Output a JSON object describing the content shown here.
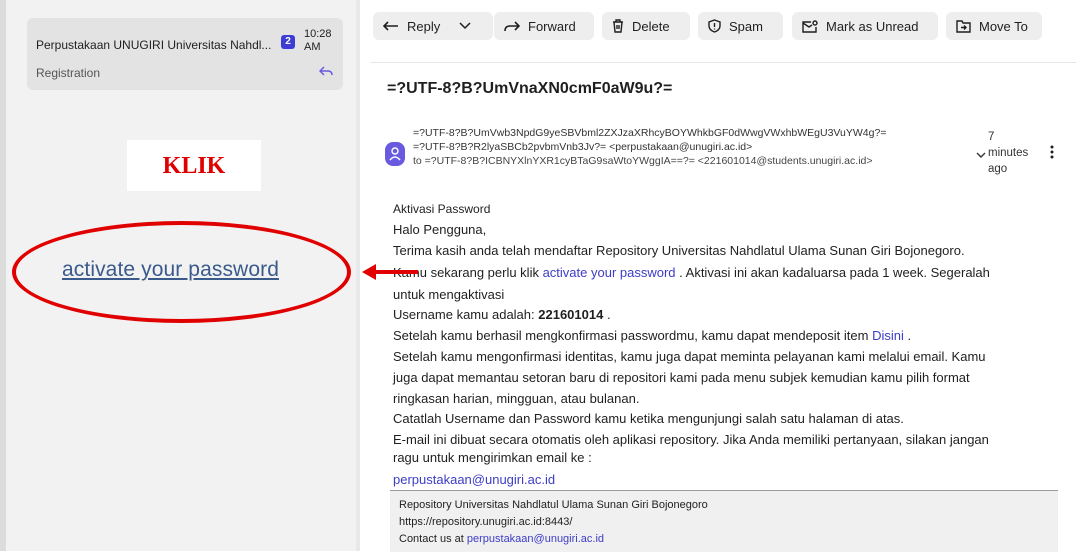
{
  "colors": {
    "accent": "#3c3cc8",
    "annotation_red": "#e00000",
    "badge": "#3d3dd6",
    "avatar": "#6a5ae0"
  },
  "inbox": {
    "item": {
      "sender": "Perpustakaan UNUGIRI Universitas Nahdl...",
      "badge_count": "2",
      "time_line1": "10:28",
      "time_line2": "AM",
      "subject": "Registration",
      "reply_icon": "reply-icon"
    }
  },
  "annotation": {
    "klik": "KLIK",
    "zoomed_link": "activate your password"
  },
  "toolbar": {
    "reply": "Reply",
    "forward": "Forward",
    "delete": "Delete",
    "spam": "Spam",
    "mark_unread": "Mark as Unread",
    "move_to": "Move To"
  },
  "email": {
    "subject": "=?UTF-8?B?UmVnaXN0cmF0aW9u?=",
    "from_line1": "=?UTF-8?B?UmVwb3NpdG9yeSBVbml2ZXJzaXRhcyBOYWhkbGF0dWwgVWxhbWEgU3VuYW4g?=",
    "from_line2": "=?UTF-8?B?R2lyaSBCb2pvbmVnb3Jv?= <perpustakaan@unugiri.ac.id>",
    "to_line": "to =?UTF-8?B?ICBNYXlnYXR1cyBTaG9saWtoYWggIA==?= <221601014@students.unugiri.ac.id>",
    "when_line1": "7",
    "when_line2": "minutes",
    "when_line3": "ago",
    "body": {
      "aktivasi": "Aktivasi Password",
      "halo": "Halo Pengguna,",
      "terima": "Terima kasih anda telah mendaftar Repository Universitas Nahdlatul Ulama Sunan Giri Bojonegoro.",
      "kamu_prefix": "Kamu sekarang perlu klik ",
      "kamu_link": "activate your password",
      "kamu_suffix": " . Aktivasi ini akan kadaluarsa pada 1 week. Segeralah",
      "kamu_line2": "untuk mengaktivasi",
      "user_prefix": "Username kamu adalah: ",
      "user_value": "221601014",
      "user_suffix": " .",
      "setelah1_prefix": "Setelah kamu berhasil mengkonfirmasi passwordmu, kamu dapat mendeposit item ",
      "setelah1_link": "Disini",
      "setelah1_suffix": " .",
      "setelah2_line1": "Setelah kamu mengonfirmasi identitas, kamu juga dapat meminta pelayanan kami melalui email. Kamu",
      "setelah2_line2": "juga dapat memantau setoran baru di repositori kami pada menu subjek kemudian kamu pilih format",
      "setelah2_line3": "ringkasan harian, mingguan, atau bulanan.",
      "catat": "Catatlah Username dan Password kamu ketika mengunjungi salah satu halaman di atas.",
      "email_line1": "E-mail ini dibuat secara otomatis oleh aplikasi repository. Jika Anda memiliki pertanyaan, silakan jangan",
      "email_line2": "ragu untuk mengirimkan email ke :",
      "contact_email": "perpustakaan@unugiri.ac.id"
    },
    "footer": {
      "line1": "Repository Universitas Nahdlatul Ulama Sunan Giri Bojonegoro",
      "url": "https://repository.unugiri.ac.id:8443/",
      "contact_prefix": "Contact us at ",
      "contact_email": "perpustakaan@unugiri.ac.id"
    }
  }
}
